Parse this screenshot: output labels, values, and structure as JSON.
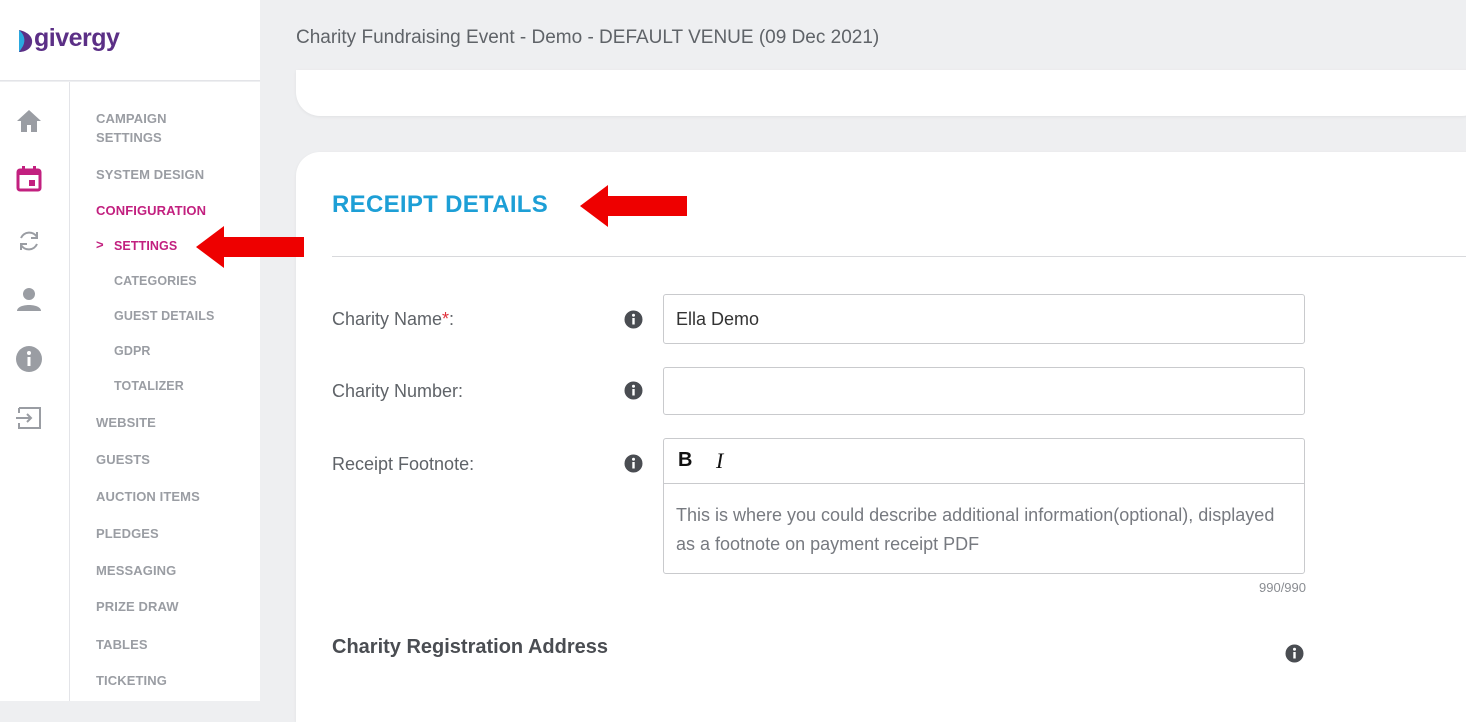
{
  "brand": {
    "name": "givergy"
  },
  "header": {
    "title": "Charity Fundraising Event - Demo - DEFAULT VENUE (09 Dec 2021)"
  },
  "rail": {
    "icons": [
      "home-icon",
      "calendar-icon",
      "refresh-icon",
      "user-icon",
      "info-icon",
      "logout-icon"
    ]
  },
  "nav": {
    "campaign_settings": "CAMPAIGN SETTINGS",
    "system_design": "SYSTEM DESIGN",
    "configuration": "CONFIGURATION",
    "chevron": ">",
    "settings": "SETTINGS",
    "categories": "CATEGORIES",
    "guest_details": "GUEST DETAILS",
    "gdpr": "GDPR",
    "totalizer": "TOTALIZER",
    "website": "WEBSITE",
    "guests": "GUESTS",
    "auction_items": "AUCTION ITEMS",
    "pledges": "PLEDGES",
    "messaging": "MESSAGING",
    "prize_draw": "PRIZE DRAW",
    "tables": "TABLES",
    "ticketing": "TICKETING"
  },
  "form": {
    "section_title": "RECEIPT DETAILS",
    "charity_name_label": "Charity Name",
    "required_mark": "*",
    "label_colon": ":",
    "charity_name_value": "Ella Demo",
    "charity_number_label": "Charity Number:",
    "charity_number_value": "",
    "receipt_footnote_label": "Receipt Footnote:",
    "toolbar": {
      "bold": "B",
      "italic": "I"
    },
    "footnote_placeholder": "This is where you could describe additional information(optional), displayed as a footnote on payment receipt PDF",
    "char_counter": "990/990",
    "address_heading": "Charity Registration Address"
  },
  "colors": {
    "accent_active": "#c2207f",
    "section_title": "#1d9fd6",
    "annotation_arrow": "#ee0000"
  }
}
